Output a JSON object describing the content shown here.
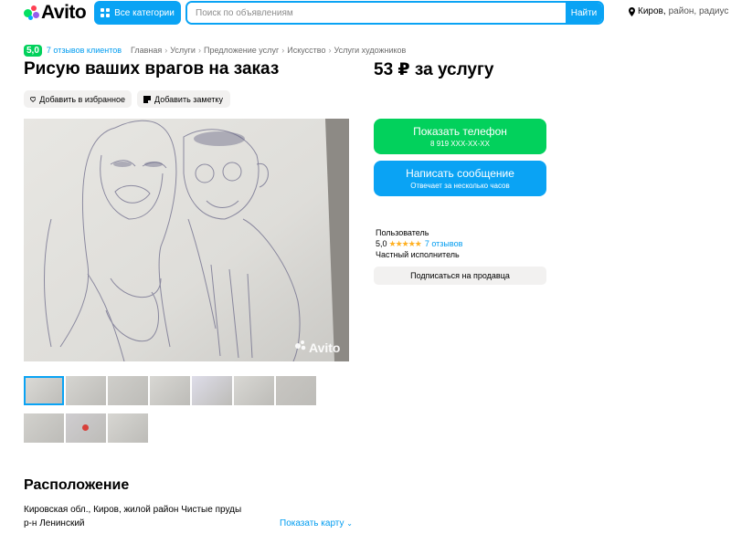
{
  "header": {
    "logo_text": "Avito",
    "categories_label": "Все категории",
    "search_placeholder": "Поиск по объявлениям",
    "search_button": "Найти",
    "location_city": "Киров,",
    "location_rest": "район, радиус"
  },
  "rating": {
    "score": "5,0",
    "reviews": "7 отзывов клиентов"
  },
  "breadcrumbs": [
    "Главная",
    "Услуги",
    "Предложение услуг",
    "Искусство",
    "Услуги художников"
  ],
  "listing": {
    "title": "Рисую ваших врагов на заказ",
    "price": "53 ₽ за услугу",
    "favorite_label": "Добавить в избранное",
    "note_label": "Добавить заметку",
    "watermark": "Avito",
    "thumbnail_count": 10,
    "active_thumbnail": 1
  },
  "contact": {
    "phone_button": "Показать телефон",
    "phone_number": "8 919 XXX-XX-XX",
    "message_button": "Написать сообщение",
    "message_sub": "Отвечает за несколько часов"
  },
  "seller": {
    "name": "Пользователь",
    "score": "5,0",
    "stars": "★★★★★",
    "reviews": "7 отзывов",
    "type": "Частный исполнитель",
    "subscribe_label": "Подписаться на продавца"
  },
  "location_section": {
    "title": "Расположение",
    "address_line1": "Кировская обл., Киров, жилой район Чистые пруды",
    "address_line2": "р-н Ленинский",
    "show_map": "Показать карту"
  },
  "colors": {
    "blue": "#0aa3f4",
    "green": "#02d15c",
    "link": "#009cf0",
    "star": "#ffb021",
    "pill_bg": "#f2f1f0"
  }
}
